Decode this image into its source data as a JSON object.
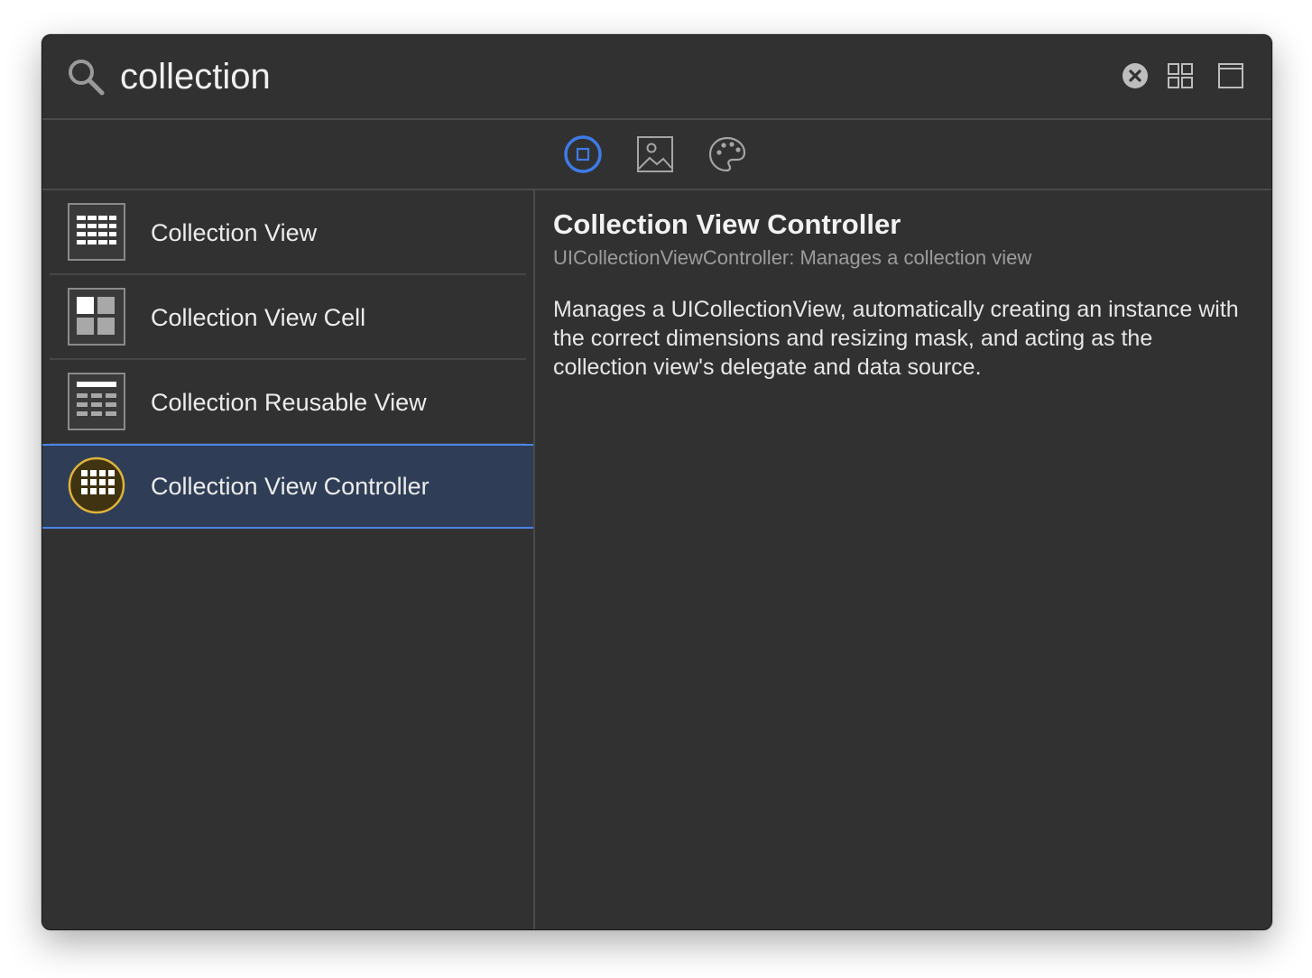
{
  "search": {
    "value": "collection",
    "icon": "magnifying-glass-icon"
  },
  "toolbar": {
    "clear_icon": "clear-circle-x-icon",
    "grid_icon": "grid-view-icon",
    "window_icon": "window-view-icon"
  },
  "library_tabs": [
    {
      "id": "objects",
      "icon": "objects-square-icon",
      "selected": true
    },
    {
      "id": "media",
      "icon": "image-icon",
      "selected": false
    },
    {
      "id": "colors",
      "icon": "palette-icon",
      "selected": false
    }
  ],
  "results": [
    {
      "label": "Collection View",
      "icon": "collection-view-icon",
      "selected": false
    },
    {
      "label": "Collection View Cell",
      "icon": "collection-view-cell-icon",
      "selected": false
    },
    {
      "label": "Collection Reusable View",
      "icon": "collection-reusable-view-icon",
      "selected": false
    },
    {
      "label": "Collection View Controller",
      "icon": "collection-view-controller-icon",
      "selected": true
    }
  ],
  "detail": {
    "title": "Collection View Controller",
    "subtitle": "UICollectionViewController: Manages a collection view",
    "description": "Manages a UICollectionView, automatically creating an instance with the correct dimensions and resizing mask, and acting as the collection view's delegate and data source."
  },
  "colors": {
    "window_bg": "#323131",
    "selection_bg": "#2f3e56",
    "selection_border": "#4a84e8",
    "tab_accent": "#3d7be8",
    "controller_icon": "#e0b33a"
  }
}
